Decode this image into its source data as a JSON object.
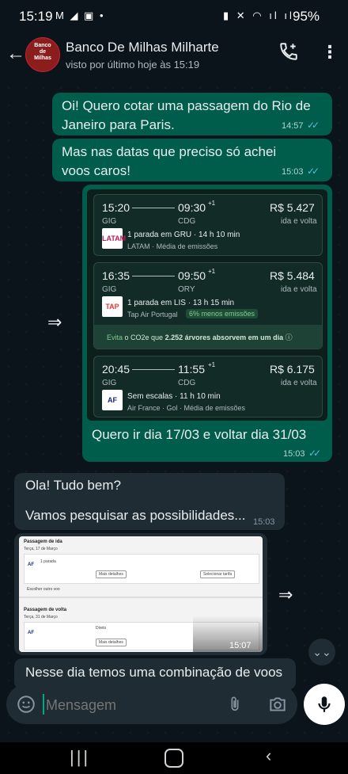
{
  "status_bar": {
    "time": "15:19",
    "battery": "95%",
    "left_icons": "M ◢ ▣ •",
    "right_icons": "▮ ✕ ◠ ıl ıl"
  },
  "header": {
    "contact_name": "Banco De Milhas Milharte",
    "status": "visto por último hoje às 15:19",
    "avatar_text": "Banco\nde\nMilhas"
  },
  "messages": {
    "m1": {
      "text": "Oi! Quero cotar uma passagem do Rio de Janeiro para Paris.",
      "time": "14:57"
    },
    "m2": {
      "text": "Mas nas datas que preciso só achei voos caros!",
      "time": "15:03"
    },
    "m3": {
      "caption": "Quero ir dia 17/03 e voltar dia 31/03",
      "time": "15:03"
    },
    "m4": {
      "line1": "Ola! Tudo bem?",
      "line2": "Vamos pesquisar as possibilidades...",
      "time": "15:03"
    },
    "m5": {
      "time": "15:07"
    },
    "m6": {
      "text": "Nesse dia temos uma combinação de voos"
    }
  },
  "flights": [
    {
      "depart": "15:20",
      "arrive": "09:30",
      "plus": "+1",
      "from": "GIG",
      "to": "CDG",
      "price": "R$ 5.427",
      "price_note": "ida e volta",
      "detail": "1 parada em GRU · 14 h 10 min",
      "airline": "LATAM · Média de emissões",
      "logo": "LATAM"
    },
    {
      "depart": "16:35",
      "arrive": "09:50",
      "plus": "+1",
      "from": "GIG",
      "to": "ORY",
      "price": "R$ 5.484",
      "price_note": "ida e volta",
      "detail": "1 parada em LIS · 13 h 15 min",
      "airline": "Tap Air Portugal",
      "emission_badge": "6% menos emissões",
      "logo": "TAP",
      "eco_note_prefix": "Evita",
      "eco_note_middle": " o CO2e que ",
      "eco_note_bold": "2.252 árvores absorvem em um dia",
      "eco_note_suffix": " ⓘ"
    },
    {
      "depart": "20:45",
      "arrive": "11:55",
      "plus": "+1",
      "from": "GIG",
      "to": "CDG",
      "price": "R$ 6.175",
      "price_note": "ida e volta",
      "detail": "Sem escalas · 11 h 10 min",
      "airline": "Air France · Gol · Média de emissões",
      "logo": "AF"
    }
  ],
  "screenshot": {
    "outbound_title": "Passagem de ida",
    "outbound_date": "Terça, 17 de Março",
    "return_title": "Passagem de volta",
    "return_date": "Terça, 31 de Março",
    "stops_1": "1 parada",
    "stops_2": "Direto",
    "details_btn": "Mais detalhes",
    "select_btn": "Selecionar tarifa",
    "filter_label": "Escolher outro voo"
  },
  "input": {
    "placeholder": "Mensagem"
  },
  "icons": {
    "back": "back-arrow-icon",
    "call": "add-call-icon",
    "menu": "more-vert-icon",
    "emoji": "sticker-icon",
    "attach": "paperclip-icon",
    "camera": "camera-icon",
    "mic": "microphone-icon",
    "forward": "forward-icon",
    "scroll": "scroll-down-icon"
  },
  "colors": {
    "outgoing": "#005c4b",
    "incoming": "#1f2c34",
    "background": "#0b141a",
    "read_ticks": "#53bdeb"
  }
}
